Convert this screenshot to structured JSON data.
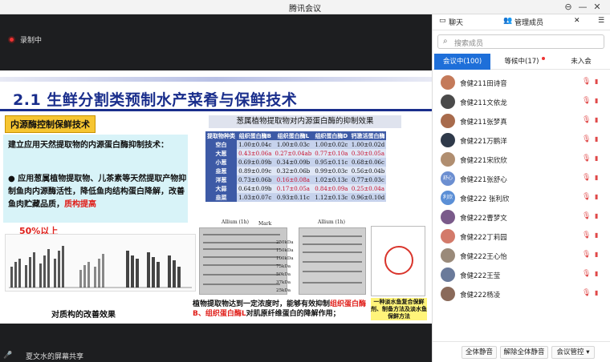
{
  "window": {
    "title": "腾讯会议"
  },
  "recording": {
    "label": "录制中"
  },
  "slide": {
    "title": "2.1 生鲜分割类预制水产菜肴与保鲜技术",
    "badge": "内源酶控制保鲜技术",
    "heading": "建立应用天然提取物的内源蛋白酶抑制技术：",
    "bullet_prefix": "应用葱属植物提取物、儿茶素等天然提取产物抑制鱼肉内源酶活性，降低鱼肉结构蛋白降解，改善鱼肉贮藏品质，",
    "bullet_highlight": "质构提高",
    "percent": "50%以上",
    "table_title": "葱属植物提取物对内源蛋白酶的抑制效果",
    "table": {
      "headers": [
        "提取物种类",
        "组织蛋白酶B",
        "组织蛋白酶L",
        "组织蛋白酶D",
        "钙激活蛋白酶"
      ],
      "rows": [
        [
          "空白",
          "1.00±0.04c",
          "1.00±0.03c",
          "1.00±0.02c",
          "1.00±0.02d"
        ],
        [
          "大葱",
          "0.43±0.06a",
          "0.27±0.04ab",
          "0.77±0.10a",
          "0.30±0.05a"
        ],
        [
          "小葱",
          "0.69±0.09b",
          "0.34±0.09b",
          "0.95±0.11c",
          "0.68±0.06c"
        ],
        [
          "韭葱",
          "0.89±0.09c",
          "0.32±0.06b",
          "0.99±0.03c",
          "0.56±0.04b"
        ],
        [
          "洋葱",
          "0.73±0.06b",
          "0.16±0.08a",
          "1.02±0.13c",
          "0.77±0.03c"
        ],
        [
          "大蒜",
          "0.64±0.09b",
          "0.17±0.05a",
          "0.84±0.09a",
          "0.25±0.04a"
        ],
        [
          "韭菜",
          "1.03±0.07c",
          "0.93±0.11c",
          "1.12±0.13c",
          "0.96±0.10d"
        ]
      ]
    },
    "chart_caption": "对质构的改善效果",
    "gel1_label": "Allium (1h)",
    "gel2_label": "Allium (1h)",
    "gel_markers": [
      "250kDa",
      "150kDa",
      "100kDa",
      "75kDa",
      "50kDa",
      "37kDa",
      "25kDa"
    ],
    "marker_label": "Mark",
    "conclusion_prefix": "植物提取物达到一定浓度时，能够有效抑制",
    "conclusion_hl1": "组织蛋白酶B、组织蛋白酶L",
    "conclusion_suffix": "对肌原纤维蛋白的降解作用；",
    "patent_caption": "一种淡水鱼复合保鲜剂、制备方法及淡水鱼保鲜方法"
  },
  "bottom": {
    "sharer": "夏文水的屏幕共享"
  },
  "panel": {
    "tabs": {
      "chat": "聊天",
      "manage": "管理成员",
      "close": "✕"
    },
    "search_placeholder": "搜索成员",
    "subtabs": {
      "in_meeting": "会议中(100)",
      "waiting": "等候中(17)",
      "not_joined": "未入会"
    },
    "members": [
      {
        "name": "食健211田诗音",
        "avatar": ""
      },
      {
        "name": "食健211文依龙",
        "avatar": ""
      },
      {
        "name": "食健211张梦真",
        "avatar": ""
      },
      {
        "name": "食健221万鹏洋",
        "avatar": ""
      },
      {
        "name": "食健221宋欣欣",
        "avatar": ""
      },
      {
        "name": "食健221张舒心",
        "avatar": "舒心"
      },
      {
        "name": "食健222 张利欣",
        "avatar": "利欣"
      },
      {
        "name": "食健222曹梦文",
        "avatar": ""
      },
      {
        "name": "食健222丁莉园",
        "avatar": ""
      },
      {
        "name": "食健222王心怡",
        "avatar": ""
      },
      {
        "name": "食健222王莹",
        "avatar": ""
      },
      {
        "name": "食健222杨凌",
        "avatar": ""
      }
    ],
    "footer": {
      "mute_all": "全体静音",
      "unmute_all": "解除全体静音",
      "controls": "会议管控 ▾"
    }
  },
  "colors": {
    "accent": "#1e6fd9",
    "slide_title": "#1a2e8c",
    "table_header": "#3d5aa6",
    "highlight": "#e0201b"
  }
}
